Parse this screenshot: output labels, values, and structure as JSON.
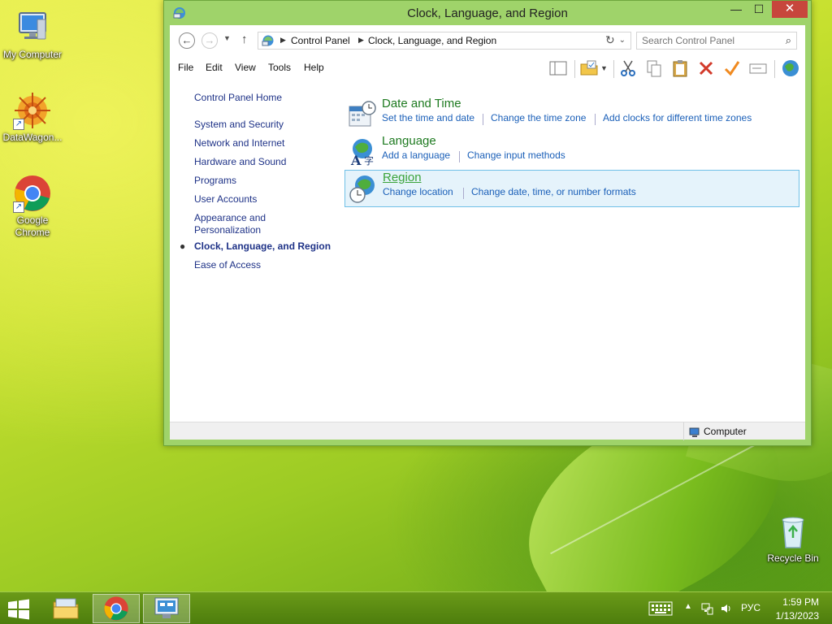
{
  "desktop": {
    "icons": [
      {
        "label": "My Computer"
      },
      {
        "label": "DataWagon..."
      },
      {
        "label": "Google Chrome"
      },
      {
        "label": "Recycle Bin"
      }
    ]
  },
  "window": {
    "title": "Clock, Language, and Region",
    "controls": {
      "minimize": "—",
      "maximize": "☐",
      "close": "✕"
    },
    "address": {
      "crumbs": [
        "Control Panel",
        "Clock, Language, and Region"
      ]
    },
    "search": {
      "placeholder": "Search Control Panel"
    },
    "menu": [
      "File",
      "Edit",
      "View",
      "Tools",
      "Help"
    ],
    "left_nav": {
      "home": "Control Panel Home",
      "items": [
        "System and Security",
        "Network and Internet",
        "Hardware and Sound",
        "Programs",
        "User Accounts",
        "Appearance and",
        "Personalization",
        "Clock, Language, and Region",
        "Ease of Access"
      ]
    },
    "categories": [
      {
        "title": "Date and Time",
        "links": [
          "Set the time and date",
          "Change the time zone",
          "Add clocks for different time zones"
        ]
      },
      {
        "title": "Language",
        "links": [
          "Add a language",
          "Change input methods"
        ]
      },
      {
        "title": "Region",
        "links": [
          "Change location",
          "Change date, time, or number formats"
        ]
      }
    ],
    "status": {
      "computer": "Computer"
    }
  },
  "taskbar": {
    "language": "РУС",
    "time": "1:59 PM",
    "date": "1/13/2023"
  },
  "colors": {
    "window_frame": "#9fd36a",
    "link": "#1a5fb8",
    "category_title": "#1e7a20",
    "close_button": "#c7463c",
    "taskbar": "#5a8a12"
  }
}
